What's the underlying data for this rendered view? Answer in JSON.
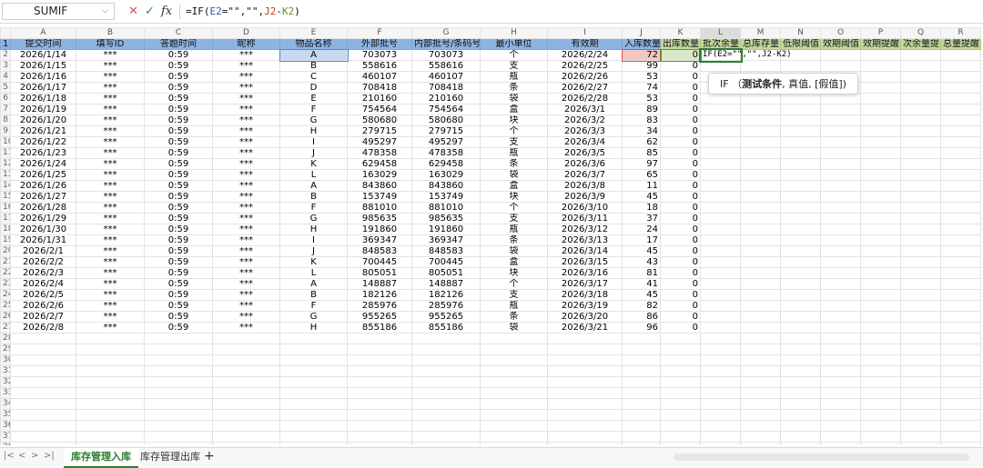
{
  "formula_bar": {
    "name_box": "SUMIF",
    "fx_label": "fx",
    "formula_parts": [
      "=IF(",
      "E2",
      "=\"\",\"\",",
      "J2",
      "-",
      "K2",
      ")"
    ]
  },
  "columns": [
    "A",
    "B",
    "C",
    "D",
    "E",
    "F",
    "G",
    "H",
    "I",
    "J",
    "K",
    "L",
    "M",
    "N",
    "O",
    "P",
    "Q",
    "R"
  ],
  "header_labels": [
    "提交时间",
    "填写ID",
    "答题时间",
    "昵称",
    "物品名称",
    "外部批号",
    "内部批号/条码号",
    "最小单位",
    "有效期",
    "入库数量",
    "出库数量",
    "批次余量",
    "总库存量",
    "低限阈值",
    "效期阈值",
    "效期提醒",
    "次余量提",
    "总量提醒"
  ],
  "rows": [
    [
      "2026/1/14",
      "***",
      "0:59",
      "***",
      "A",
      "703073",
      "703073",
      "个",
      "2026/2/24",
      "72",
      "0"
    ],
    [
      "2026/1/15",
      "***",
      "0:59",
      "***",
      "B",
      "558616",
      "558616",
      "支",
      "2026/2/25",
      "99",
      "0"
    ],
    [
      "2026/1/16",
      "***",
      "0:59",
      "***",
      "C",
      "460107",
      "460107",
      "瓶",
      "2026/2/26",
      "53",
      "0"
    ],
    [
      "2026/1/17",
      "***",
      "0:59",
      "***",
      "D",
      "708418",
      "708418",
      "条",
      "2026/2/27",
      "74",
      "0"
    ],
    [
      "2026/1/18",
      "***",
      "0:59",
      "***",
      "E",
      "210160",
      "210160",
      "袋",
      "2026/2/28",
      "53",
      "0"
    ],
    [
      "2026/1/19",
      "***",
      "0:59",
      "***",
      "F",
      "754564",
      "754564",
      "盒",
      "2026/3/1",
      "89",
      "0"
    ],
    [
      "2026/1/20",
      "***",
      "0:59",
      "***",
      "G",
      "580680",
      "580680",
      "块",
      "2026/3/2",
      "83",
      "0"
    ],
    [
      "2026/1/21",
      "***",
      "0:59",
      "***",
      "H",
      "279715",
      "279715",
      "个",
      "2026/3/3",
      "34",
      "0"
    ],
    [
      "2026/1/22",
      "***",
      "0:59",
      "***",
      "I",
      "495297",
      "495297",
      "支",
      "2026/3/4",
      "62",
      "0"
    ],
    [
      "2026/1/23",
      "***",
      "0:59",
      "***",
      "J",
      "478358",
      "478358",
      "瓶",
      "2026/3/5",
      "85",
      "0"
    ],
    [
      "2026/1/24",
      "***",
      "0:59",
      "***",
      "K",
      "629458",
      "629458",
      "条",
      "2026/3/6",
      "97",
      "0"
    ],
    [
      "2026/1/25",
      "***",
      "0:59",
      "***",
      "L",
      "163029",
      "163029",
      "袋",
      "2026/3/7",
      "65",
      "0"
    ],
    [
      "2026/1/26",
      "***",
      "0:59",
      "***",
      "A",
      "843860",
      "843860",
      "盒",
      "2026/3/8",
      "11",
      "0"
    ],
    [
      "2026/1/27",
      "***",
      "0:59",
      "***",
      "B",
      "153749",
      "153749",
      "块",
      "2026/3/9",
      "45",
      "0"
    ],
    [
      "2026/1/28",
      "***",
      "0:59",
      "***",
      "F",
      "881010",
      "881010",
      "个",
      "2026/3/10",
      "18",
      "0"
    ],
    [
      "2026/1/29",
      "***",
      "0:59",
      "***",
      "G",
      "985635",
      "985635",
      "支",
      "2026/3/11",
      "37",
      "0"
    ],
    [
      "2026/1/30",
      "***",
      "0:59",
      "***",
      "H",
      "191860",
      "191860",
      "瓶",
      "2026/3/12",
      "24",
      "0"
    ],
    [
      "2026/1/31",
      "***",
      "0:59",
      "***",
      "I",
      "369347",
      "369347",
      "条",
      "2026/3/13",
      "17",
      "0"
    ],
    [
      "2026/2/1",
      "***",
      "0:59",
      "***",
      "J",
      "848583",
      "848583",
      "袋",
      "2026/3/14",
      "45",
      "0"
    ],
    [
      "2026/2/2",
      "***",
      "0:59",
      "***",
      "K",
      "700445",
      "700445",
      "盒",
      "2026/3/15",
      "43",
      "0"
    ],
    [
      "2026/2/3",
      "***",
      "0:59",
      "***",
      "L",
      "805051",
      "805051",
      "块",
      "2026/3/16",
      "81",
      "0"
    ],
    [
      "2026/2/4",
      "***",
      "0:59",
      "***",
      "A",
      "148887",
      "148887",
      "个",
      "2026/3/17",
      "41",
      "0"
    ],
    [
      "2026/2/5",
      "***",
      "0:59",
      "***",
      "B",
      "182126",
      "182126",
      "支",
      "2026/3/18",
      "45",
      "0"
    ],
    [
      "2026/2/6",
      "***",
      "0:59",
      "***",
      "F",
      "285976",
      "285976",
      "瓶",
      "2026/3/19",
      "82",
      "0"
    ],
    [
      "2026/2/7",
      "***",
      "0:59",
      "***",
      "G",
      "955265",
      "955265",
      "条",
      "2026/3/20",
      "86",
      "0"
    ],
    [
      "2026/2/8",
      "***",
      "0:59",
      "***",
      "H",
      "855186",
      "855186",
      "袋",
      "2026/3/21",
      "96",
      "0"
    ]
  ],
  "editing_cell_text": "IF(E2=\"\",\"\",J2-K2)",
  "tooltip": {
    "fn": "IF",
    "open": "（",
    "arg1": "测试条件",
    "rest": ", 真值, [假值])"
  },
  "sheet_tabs": [
    "库存管理入库",
    "库存管理出库"
  ],
  "active_tab": 0,
  "colors": {
    "header_blue": "#8db3e2",
    "header_green": "#c4d79b",
    "accent": "#2e7d32"
  }
}
